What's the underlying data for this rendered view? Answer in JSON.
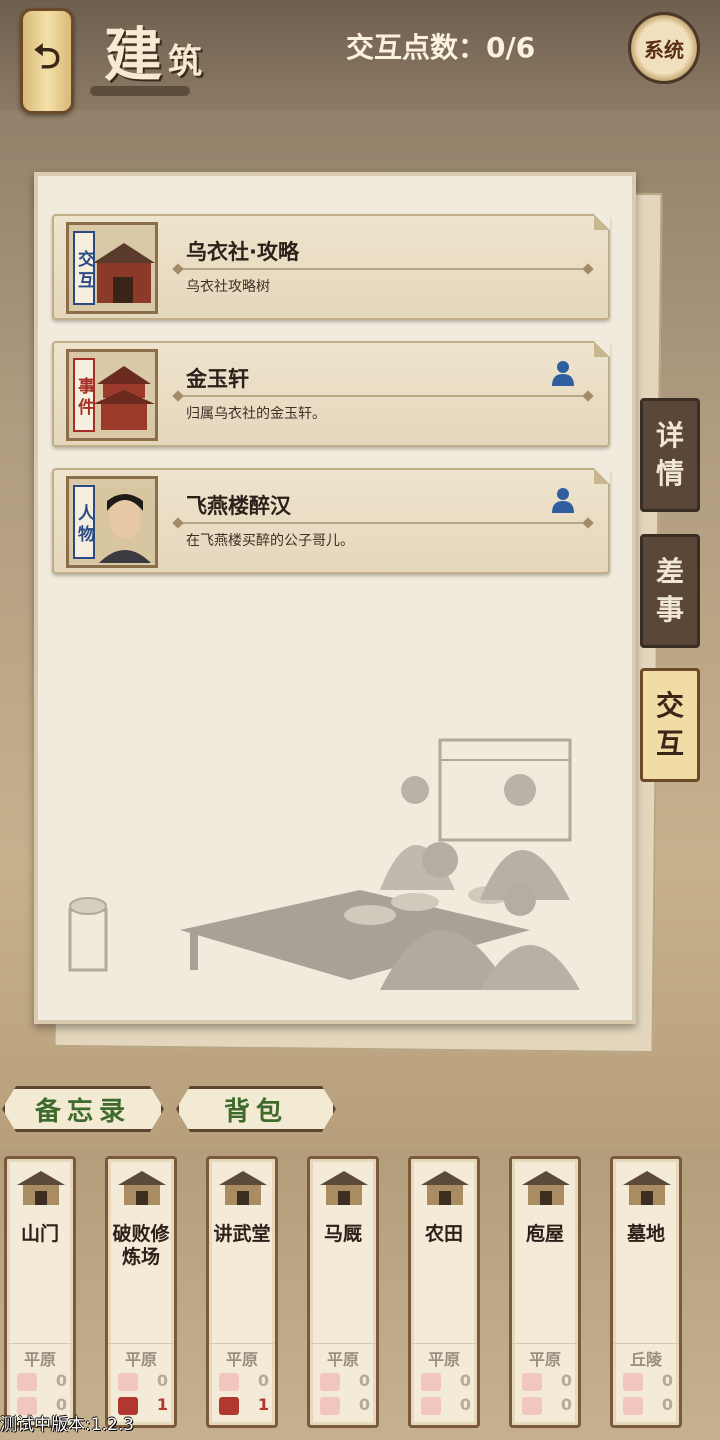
{
  "header": {
    "title_main": "建",
    "title_sub": "筑",
    "points_text": "交互点数：0/6",
    "system_label": "系统"
  },
  "cards": [
    {
      "tag": "交互",
      "tag_color": "blue",
      "title": "乌衣社·攻略",
      "desc": "乌衣社攻略树",
      "has_person": false
    },
    {
      "tag": "事件",
      "tag_color": "red",
      "title": "金玉轩",
      "desc": "归属乌衣社的金玉轩。",
      "has_person": true
    },
    {
      "tag": "人物",
      "tag_color": "blue",
      "title": "飞燕楼醉汉",
      "desc": "在飞燕楼买醉的公子哥儿。",
      "has_person": true
    }
  ],
  "side_tabs": [
    {
      "label": "详情",
      "active": false
    },
    {
      "label": "差事",
      "active": false
    },
    {
      "label": "交互",
      "active": true
    }
  ],
  "memo_tabs": [
    "备忘录",
    "背包"
  ],
  "buildings": [
    {
      "name": "山门",
      "terrain": "平原",
      "stat1": "0",
      "stat2": "0",
      "stat2_active": false,
      "icon": "gate-icon"
    },
    {
      "name": "破败修炼场",
      "terrain": "平原",
      "stat1": "0",
      "stat2": "1",
      "stat2_active": true,
      "icon": "ruined-yard-icon"
    },
    {
      "name": "讲武堂",
      "terrain": "平原",
      "stat1": "0",
      "stat2": "1",
      "stat2_active": true,
      "icon": "hall-icon"
    },
    {
      "name": "马厩",
      "terrain": "平原",
      "stat1": "0",
      "stat2": "0",
      "stat2_active": false,
      "icon": "stable-icon"
    },
    {
      "name": "农田",
      "terrain": "平原",
      "stat1": "0",
      "stat2": "0",
      "stat2_active": false,
      "icon": "farm-icon"
    },
    {
      "name": "庖屋",
      "terrain": "平原",
      "stat1": "0",
      "stat2": "0",
      "stat2_active": false,
      "icon": "kitchen-icon"
    },
    {
      "name": "墓地",
      "terrain": "丘陵",
      "stat1": "0",
      "stat2": "0",
      "stat2_active": false,
      "icon": "tomb-icon"
    }
  ],
  "version_text": "测试中版本:1.2.3"
}
